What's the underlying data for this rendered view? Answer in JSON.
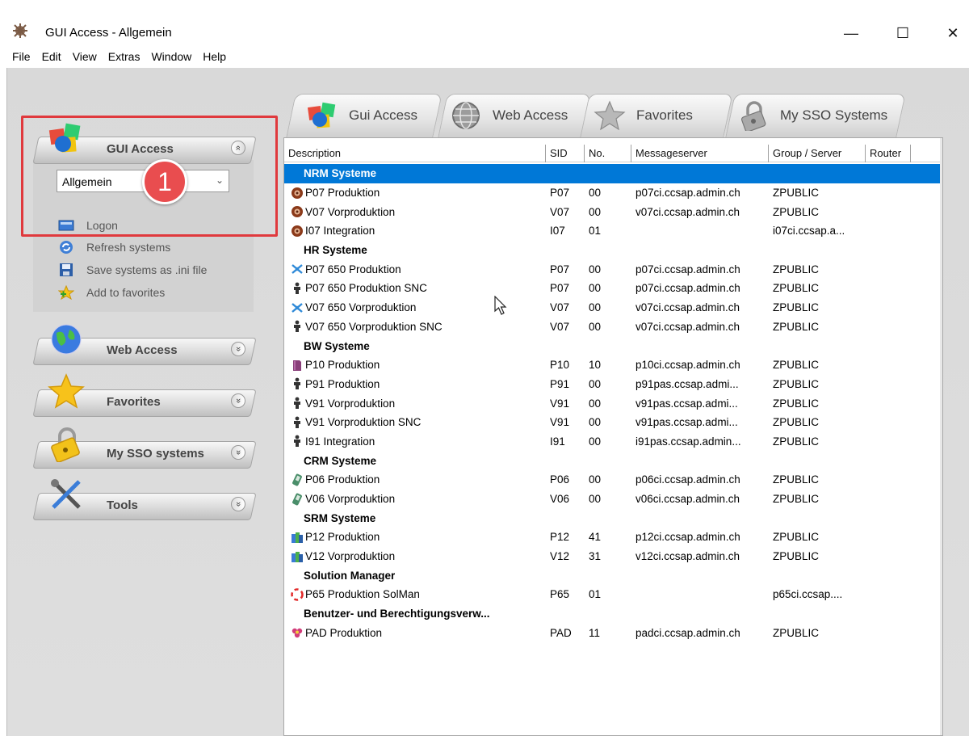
{
  "window": {
    "title": "GUI Access - Allgemein",
    "minimize_glyph": "—",
    "maximize_glyph": "☐",
    "close_glyph": "✕"
  },
  "menu": [
    "File",
    "Edit",
    "View",
    "Extras",
    "Window",
    "Help"
  ],
  "tabs": [
    {
      "label": "Gui Access",
      "icon": "cubes-icon"
    },
    {
      "label": "Web Access",
      "icon": "globe-icon"
    },
    {
      "label": "Favorites",
      "icon": "star-icon"
    },
    {
      "label": "My SSO Systems",
      "icon": "padlock-icon"
    }
  ],
  "table": {
    "columns": [
      "Description",
      "SID",
      "No.",
      "Messageserver",
      "Group / Server",
      "Router"
    ],
    "rows": [
      {
        "type": "group",
        "label": "NRM Systeme",
        "selected": true
      },
      {
        "type": "sys",
        "icon": "brown-disc-icon",
        "desc": "P07 Produktion",
        "sid": "P07",
        "no": "00",
        "ms": "p07ci.ccsap.admin.ch",
        "grp": "ZPUBLIC"
      },
      {
        "type": "sys",
        "icon": "brown-disc-icon",
        "desc": "V07 Vorproduktion",
        "sid": "V07",
        "no": "00",
        "ms": "v07ci.ccsap.admin.ch",
        "grp": "ZPUBLIC"
      },
      {
        "type": "sys",
        "icon": "brown-disc-icon",
        "desc": "I07 Integration",
        "sid": "I07",
        "no": "01",
        "ms": "",
        "grp": "i07ci.ccsap.a..."
      },
      {
        "type": "group",
        "label": "HR Systeme"
      },
      {
        "type": "sys",
        "icon": "airplane-icon",
        "desc": "P07 650 Produktion",
        "sid": "P07",
        "no": "00",
        "ms": "p07ci.ccsap.admin.ch",
        "grp": "ZPUBLIC"
      },
      {
        "type": "sys",
        "icon": "person-icon",
        "desc": "P07 650 Produktion SNC",
        "sid": "P07",
        "no": "00",
        "ms": "p07ci.ccsap.admin.ch",
        "grp": "ZPUBLIC"
      },
      {
        "type": "sys",
        "icon": "airplane-icon",
        "desc": "V07 650 Vorproduktion",
        "sid": "V07",
        "no": "00",
        "ms": "v07ci.ccsap.admin.ch",
        "grp": "ZPUBLIC"
      },
      {
        "type": "sys",
        "icon": "person-icon",
        "desc": "V07 650 Vorproduktion SNC",
        "sid": "V07",
        "no": "00",
        "ms": "v07ci.ccsap.admin.ch",
        "grp": "ZPUBLIC"
      },
      {
        "type": "group",
        "label": "BW Systeme"
      },
      {
        "type": "sys",
        "icon": "book-icon",
        "desc": "P10 Produktion",
        "sid": "P10",
        "no": "10",
        "ms": "p10ci.ccsap.admin.ch",
        "grp": "ZPUBLIC"
      },
      {
        "type": "sys",
        "icon": "person-icon",
        "desc": "P91 Produktion",
        "sid": "P91",
        "no": "00",
        "ms": "p91pas.ccsap.admi...",
        "grp": "ZPUBLIC"
      },
      {
        "type": "sys",
        "icon": "person-icon",
        "desc": "V91 Vorproduktion",
        "sid": "V91",
        "no": "00",
        "ms": "v91pas.ccsap.admi...",
        "grp": "ZPUBLIC"
      },
      {
        "type": "sys",
        "icon": "person-icon",
        "desc": "V91 Vorproduktion SNC",
        "sid": "V91",
        "no": "00",
        "ms": "v91pas.ccsap.admi...",
        "grp": "ZPUBLIC"
      },
      {
        "type": "sys",
        "icon": "person-icon",
        "desc": "I91 Integration",
        "sid": "I91",
        "no": "00",
        "ms": "i91pas.ccsap.admin...",
        "grp": "ZPUBLIC"
      },
      {
        "type": "group",
        "label": "CRM Systeme"
      },
      {
        "type": "sys",
        "icon": "phone-icon",
        "desc": "P06 Produktion",
        "sid": "P06",
        "no": "00",
        "ms": "p06ci.ccsap.admin.ch",
        "grp": "ZPUBLIC"
      },
      {
        "type": "sys",
        "icon": "phone-icon",
        "desc": "V06 Vorproduktion",
        "sid": "V06",
        "no": "00",
        "ms": "v06ci.ccsap.admin.ch",
        "grp": "ZPUBLIC"
      },
      {
        "type": "group",
        "label": "SRM Systeme"
      },
      {
        "type": "sys",
        "icon": "blocks-icon",
        "desc": "P12 Produktion",
        "sid": "P12",
        "no": "41",
        "ms": "p12ci.ccsap.admin.ch",
        "grp": "ZPUBLIC"
      },
      {
        "type": "sys",
        "icon": "blocks-icon",
        "desc": "V12 Vorproduktion",
        "sid": "V12",
        "no": "31",
        "ms": "v12ci.ccsap.admin.ch",
        "grp": "ZPUBLIC"
      },
      {
        "type": "group",
        "label": "Solution Manager"
      },
      {
        "type": "sys",
        "icon": "lifebuoy-icon",
        "desc": "P65 Produktion SolMan",
        "sid": "P65",
        "no": "01",
        "ms": "",
        "grp": "p65ci.ccsap...."
      },
      {
        "type": "group",
        "label": "Benutzer- und Berechtigungsverw..."
      },
      {
        "type": "sys",
        "icon": "flower-icon",
        "desc": "PAD Produktion",
        "sid": "PAD",
        "no": "11",
        "ms": "padci.ccsap.admin.ch",
        "grp": "ZPUBLIC"
      }
    ]
  },
  "sidebar": {
    "sections": [
      {
        "label": "GUI Access",
        "icon": "cubes-icon",
        "expanded": true,
        "chevron": "»"
      },
      {
        "label": "Web Access",
        "icon": "globe-icon",
        "chevron": "»"
      },
      {
        "label": "Favorites",
        "icon": "star-icon",
        "chevron": "»"
      },
      {
        "label": "My SSO systems",
        "icon": "padlock-icon",
        "chevron": "»"
      },
      {
        "label": "Tools",
        "icon": "tools-icon",
        "chevron": "»"
      }
    ],
    "dropdown_value": "Allgemein",
    "actions": [
      {
        "label": "Logon",
        "icon": "monitor-icon"
      },
      {
        "label": "Refresh systems",
        "icon": "refresh-icon"
      },
      {
        "label": "Save systems as .ini file",
        "icon": "floppy-icon"
      },
      {
        "label": "Add to favorites",
        "icon": "star-add-icon"
      }
    ]
  },
  "annotation": {
    "badge": "1"
  },
  "colors": {
    "selection": "#0078d7",
    "highlight": "#e0393d",
    "badge": "#e94d4f"
  }
}
